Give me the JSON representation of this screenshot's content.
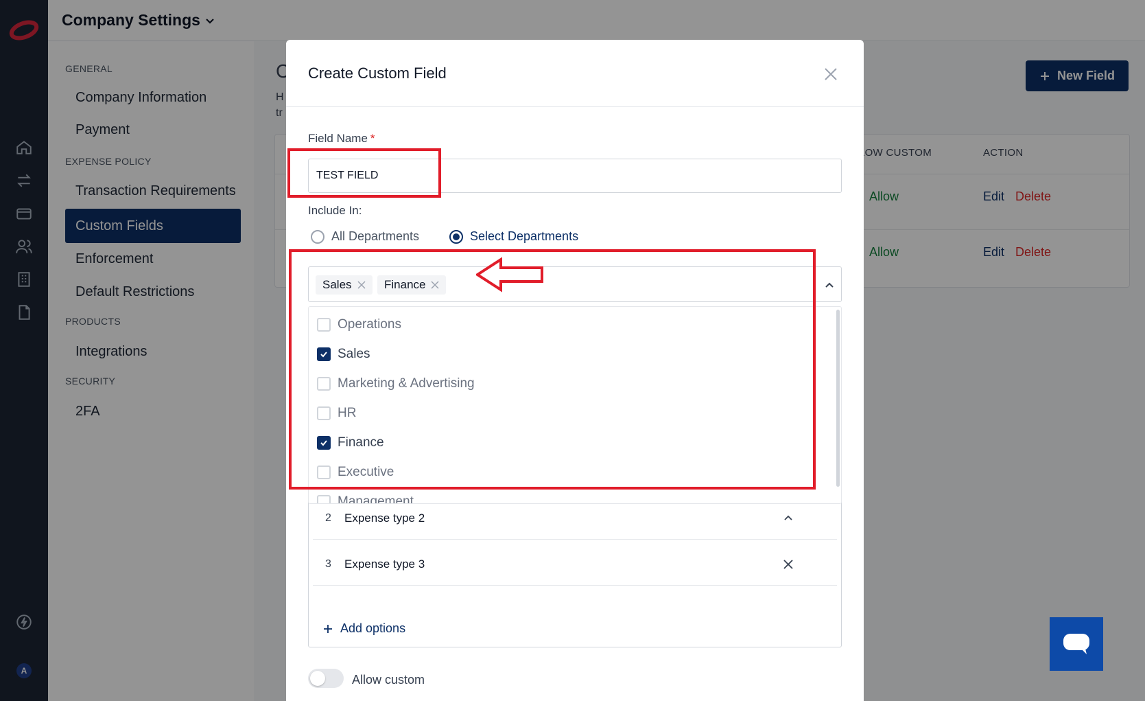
{
  "header": {
    "title": "Company Settings"
  },
  "sidebar": {
    "sections": [
      {
        "label": "GENERAL"
      },
      {
        "label": "EXPENSE POLICY"
      },
      {
        "label": "PRODUCTS"
      },
      {
        "label": "SECURITY"
      }
    ],
    "items": [
      {
        "label": "Company Information"
      },
      {
        "label": "Payment"
      },
      {
        "label": "Transaction Requirements"
      },
      {
        "label": "Custom Fields"
      },
      {
        "label": "Enforcement"
      },
      {
        "label": "Default Restrictions"
      },
      {
        "label": "Integrations"
      },
      {
        "label": "2FA"
      }
    ]
  },
  "main": {
    "title_peek": "C",
    "desc_peek": [
      "H",
      "tr"
    ],
    "new_field_label": "New Field",
    "columns": {
      "allow_custom": "ALLOW CUSTOM",
      "action": "ACTION"
    },
    "rows": [
      {
        "allow": "Allow",
        "edit": "Edit",
        "delete": "Delete"
      },
      {
        "allow": "Allow",
        "edit": "Edit",
        "delete": "Delete"
      }
    ]
  },
  "modal": {
    "title": "Create Custom Field",
    "field_name_label": "Field Name",
    "field_name_required": "*",
    "field_name_value": "TEST FIELD",
    "include_in_label": "Include In:",
    "radio_all": "All Departments",
    "radio_select": "Select Departments",
    "selected_tags": [
      "Sales",
      "Finance"
    ],
    "departments": [
      {
        "label": "Operations",
        "checked": false
      },
      {
        "label": "Sales",
        "checked": true
      },
      {
        "label": "Marketing & Advertising",
        "checked": false
      },
      {
        "label": "HR",
        "checked": false
      },
      {
        "label": "Finance",
        "checked": true
      },
      {
        "label": "Executive",
        "checked": false
      },
      {
        "label": "Management",
        "checked": false
      }
    ],
    "options": [
      {
        "num": "2",
        "name": "Expense type 2"
      },
      {
        "num": "3",
        "name": "Expense type 3"
      }
    ],
    "add_options_label": "Add options",
    "allow_custom_label": "Allow custom"
  },
  "rail": {
    "avatar_letter": "A"
  },
  "colors": {
    "brand": "#0d3067",
    "danger": "#dc2626",
    "success": "#16a34a",
    "annotation": "#e11d2a"
  }
}
